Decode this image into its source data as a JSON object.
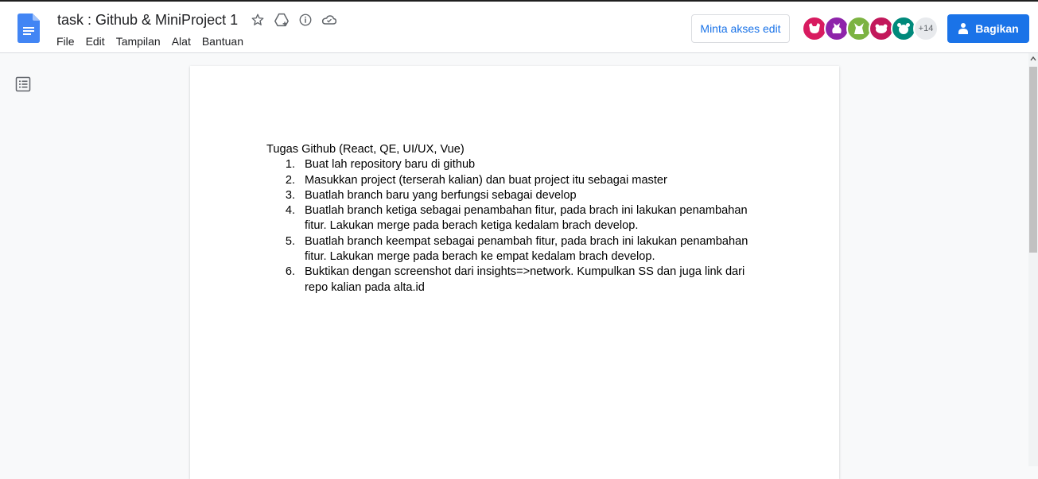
{
  "header": {
    "title": "task : Github & MiniProject 1",
    "menu": [
      "File",
      "Edit",
      "Tampilan",
      "Alat",
      "Bantuan"
    ],
    "request_edit_label": "Minta akses edit",
    "share_label": "Bagikan",
    "more_collaborators": "+14",
    "title_icons": [
      "star-icon",
      "move-to-drive-icon",
      "info-icon",
      "cloud-status-icon"
    ]
  },
  "colors": {
    "accent": "#1a73e8",
    "avatars": [
      "#d81b60",
      "#8e24aa",
      "#7cb342",
      "#c2185b",
      "#00897b"
    ]
  },
  "document": {
    "heading": "Tugas Github (React, QE, UI/UX, Vue)",
    "items": [
      {
        "num": "1.",
        "lines": [
          "Buat lah repository baru di github"
        ]
      },
      {
        "num": "2.",
        "lines": [
          "Masukkan project (terserah kalian) dan buat project itu sebagai master"
        ]
      },
      {
        "num": "3.",
        "lines": [
          "Buatlah branch baru yang berfungsi sebagai develop"
        ]
      },
      {
        "num": "4.",
        "lines": [
          "Buatlah branch ketiga sebagai penambahan fitur, pada brach ini lakukan penambahan",
          "fitur. Lakukan merge pada berach ketiga kedalam brach develop."
        ]
      },
      {
        "num": "5.",
        "lines": [
          "Buatlah branch keempat sebagai penambah fitur, pada brach ini lakukan penambahan",
          "fitur. Lakukan merge pada berach ke empat kedalam brach develop."
        ]
      },
      {
        "num": "6.",
        "lines": [
          "Buktikan dengan screenshot dari insights=>network. Kumpulkan SS dan juga link dari",
          "repo kalian pada alta.id"
        ]
      }
    ]
  }
}
